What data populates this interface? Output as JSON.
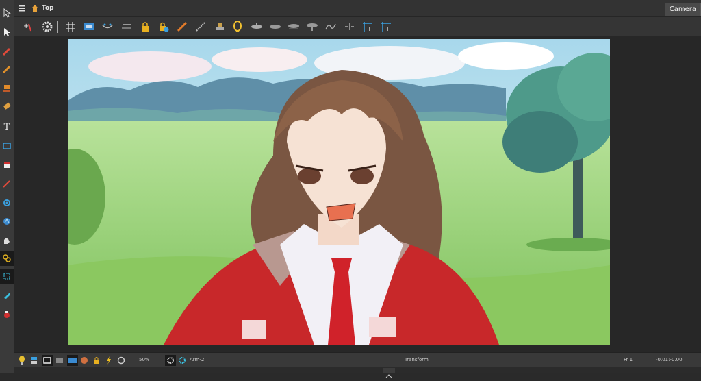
{
  "window": {
    "title": "Top",
    "camera_button": "Camera"
  },
  "toolbar": {
    "icons": [
      "add-keyframe-icon",
      "settings-gear-icon",
      "grid-icon",
      "safe-area-icon",
      "onion-skin-icon",
      "light-table-icon",
      "lock-icon",
      "lock-add-icon",
      "ruler-icon",
      "measure-icon",
      "stamp-icon",
      "lamp-icon",
      "layer-1-icon",
      "layer-2-icon",
      "layer-3-icon",
      "layer-4-icon",
      "bone-icon",
      "kinematic-icon",
      "corner-1-icon",
      "corner-2-icon"
    ]
  },
  "tools": [
    "select-icon",
    "contour-select-icon",
    "brush-icon",
    "pencil-icon",
    "stamp-tool-icon",
    "eraser-icon",
    "text-icon",
    "rectangle-icon",
    "paint-bucket-icon",
    "dropper-icon",
    "pivot-icon",
    "hand-icon",
    "glove-icon",
    "rigging-icon",
    "transform-icon",
    "pen-icon",
    "paint-icon"
  ],
  "statusbar": {
    "zoom": "50%",
    "element": "Arm-2",
    "tool_name": "Transform",
    "frame": "Fr 1",
    "coords": "-0.01:-0.00"
  },
  "colors": {
    "accent_red": "#b83030",
    "panel_bg": "#2e2e2e"
  }
}
